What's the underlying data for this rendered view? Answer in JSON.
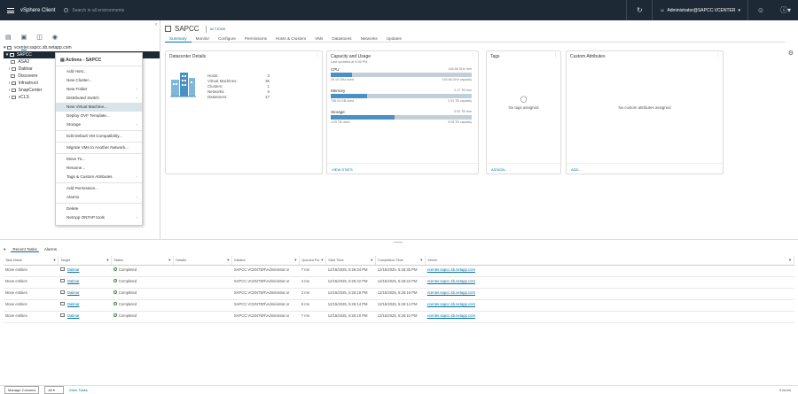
{
  "topbar": {
    "brand": "vSphere Client",
    "search_placeholder": "Search in all environments",
    "refresh_icon": "refresh-icon",
    "user": "Administrator@SAPCC.VCENTER",
    "help_icon": "help-icon",
    "smile_icon": "feedback-icon"
  },
  "tree": {
    "root": "vcenter.sapcc.sb.netapp.com",
    "selected": "SAPCC",
    "children": [
      "ASA2",
      "Datinar",
      "Discovere",
      "Infrastruct",
      "SnapCenter",
      "vCLS"
    ]
  },
  "context_menu": {
    "header": "Actions - SAPCC",
    "items": [
      {
        "label": "Add Host...",
        "chevron": false
      },
      {
        "label": "New Cluster...",
        "chevron": false
      },
      {
        "label": "New Folder",
        "chevron": true
      },
      {
        "label": "Distributed Switch",
        "chevron": true
      },
      {
        "label": "New Virtual Machine...",
        "chevron": false,
        "highlight": true
      },
      {
        "label": "Deploy OVF Template...",
        "chevron": false
      },
      {
        "label": "Storage",
        "chevron": true
      },
      {
        "label": "Edit Default VM Compatibility...",
        "chevron": false
      },
      {
        "label": "Migrate VMs to Another Network...",
        "chevron": false
      },
      {
        "label": "Move To...",
        "chevron": false
      },
      {
        "label": "Rename...",
        "chevron": false
      },
      {
        "label": "Tags & Custom Attributes",
        "chevron": true
      },
      {
        "label": "Add Permission...",
        "chevron": false
      },
      {
        "label": "Alarms",
        "chevron": true
      },
      {
        "label": "Delete",
        "chevron": false
      },
      {
        "label": "NetApp ONTAP tools",
        "chevron": true
      }
    ]
  },
  "main": {
    "title": "SAPCC",
    "actions": "ACTIONS",
    "tabs": [
      "Summary",
      "Monitor",
      "Configure",
      "Permissions",
      "Hosts & Clusters",
      "VMs",
      "Datastores",
      "Networks",
      "Updates"
    ],
    "datacenter": {
      "title": "Datacenter Details",
      "rows": [
        {
          "k": "Hosts:",
          "v": "3"
        },
        {
          "k": "Virtual Machines:",
          "v": "36"
        },
        {
          "k": "Clusters:",
          "v": "1"
        },
        {
          "k": "Networks:",
          "v": "6"
        },
        {
          "k": "Datastores:",
          "v": "17"
        }
      ]
    },
    "capacity": {
      "title": "Capacity and Usage",
      "updated": "Last updated at 5:36 PM",
      "cpu": {
        "label": "CPU",
        "right": "164.58 GHz free",
        "used": "29.10 GHz used",
        "cap": "193.68 GHz capacity",
        "pct": 15
      },
      "memory": {
        "label": "Memory",
        "right": "2.17 TB free",
        "used": "756.03 GB used",
        "cap": "2.91 TB capacity",
        "pct": 26
      },
      "storage": {
        "label": "Storage",
        "right": "5.00 TB free",
        "used": "4.05 TB used",
        "cap": "9.05 TB capacity",
        "pct": 45
      },
      "footer": "VIEW STATS"
    },
    "tags": {
      "title": "Tags",
      "empty": "No tags assigned",
      "footer": "ASSIGN..."
    },
    "attrs": {
      "title": "Custom Attributes",
      "empty": "No custom attributes assigned",
      "footer": "ADD..."
    }
  },
  "bottom": {
    "tabs": [
      "Recent Tasks",
      "Alarms"
    ],
    "columns": [
      "Task Name",
      "Target",
      "Status",
      "Details",
      "Initiator",
      "Queued For",
      "Start Time",
      "Completion Time",
      "Server"
    ],
    "rows": [
      {
        "task": "Move entities",
        "target": "Datinar",
        "status": "Completed",
        "details": "",
        "initiator": "SAPCC.VCENTER\\Administrat or",
        "queued": "7 ms",
        "start": "12/15/2025, 5:26:34 PM",
        "end": "12/15/2025, 5:26:35 PM",
        "server": "vcenter.sapcc.sb.netapp.com"
      },
      {
        "task": "Move entities",
        "target": "Datinar",
        "status": "Completed",
        "details": "",
        "initiator": "SAPCC.VCENTER\\Administrat or",
        "queued": "4 ms",
        "start": "12/15/2025, 5:26:22 PM",
        "end": "12/15/2025, 5:26:22 PM",
        "server": "vcenter.sapcc.sb.netapp.com"
      },
      {
        "task": "Move entities",
        "target": "Datinar",
        "status": "Completed",
        "details": "",
        "initiator": "SAPCC.VCENTER\\Administrat or",
        "queued": "3 ms",
        "start": "12/15/2025, 5:26:19 PM",
        "end": "12/15/2025, 5:26:19 PM",
        "server": "vcenter.sapcc.sb.netapp.com"
      },
      {
        "task": "Move entities",
        "target": "Datinar",
        "status": "Completed",
        "details": "",
        "initiator": "SAPCC.VCENTER\\Administrat or",
        "queued": "5 ms",
        "start": "12/15/2025, 5:26:14 PM",
        "end": "12/15/2025, 5:26:14 PM",
        "server": "vcenter.sapcc.sb.netapp.com"
      },
      {
        "task": "Move entities",
        "target": "Datinar",
        "status": "Completed",
        "details": "",
        "initiator": "SAPCC.VCENTER\\Administrat or",
        "queued": "7 ms",
        "start": "12/15/2025, 5:26:10 PM",
        "end": "12/15/2025, 5:26:10 PM",
        "server": "vcenter.sapcc.sb.netapp.com"
      }
    ],
    "footer": {
      "manage": "Manage Columns",
      "filter": "All",
      "more": "More Tasks",
      "count": "5 items"
    }
  }
}
